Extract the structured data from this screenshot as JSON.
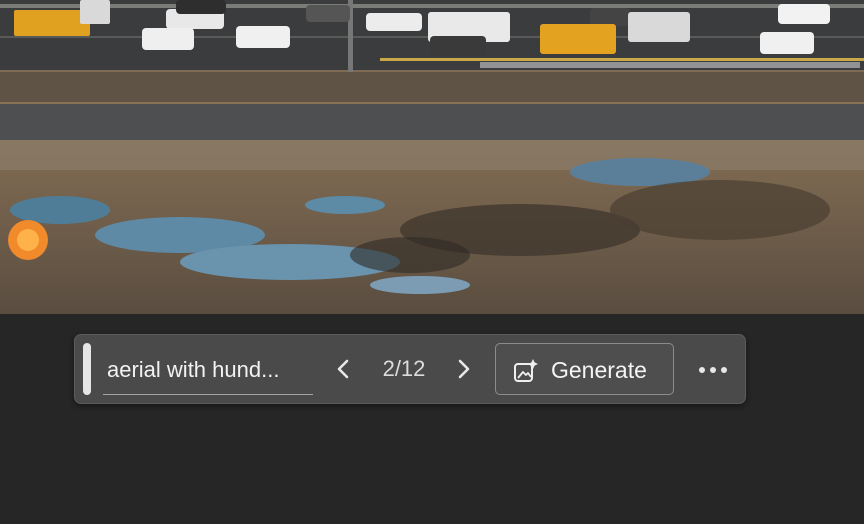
{
  "photo": {
    "subject": "aerial photo of highway traffic beside a flooded dirt lot"
  },
  "toolbar": {
    "prompt_text": "aerial with hund...",
    "prev_icon": "chevron-left-icon",
    "next_icon": "chevron-right-icon",
    "counter": "2/12",
    "generate_label": "Generate",
    "generate_icon": "sparkle-image-icon",
    "more_icon": "ellipsis-icon"
  },
  "colors": {
    "page_background": "#262626",
    "toolbar_background": "#4a4a4a",
    "text": "#f2f2f2"
  }
}
